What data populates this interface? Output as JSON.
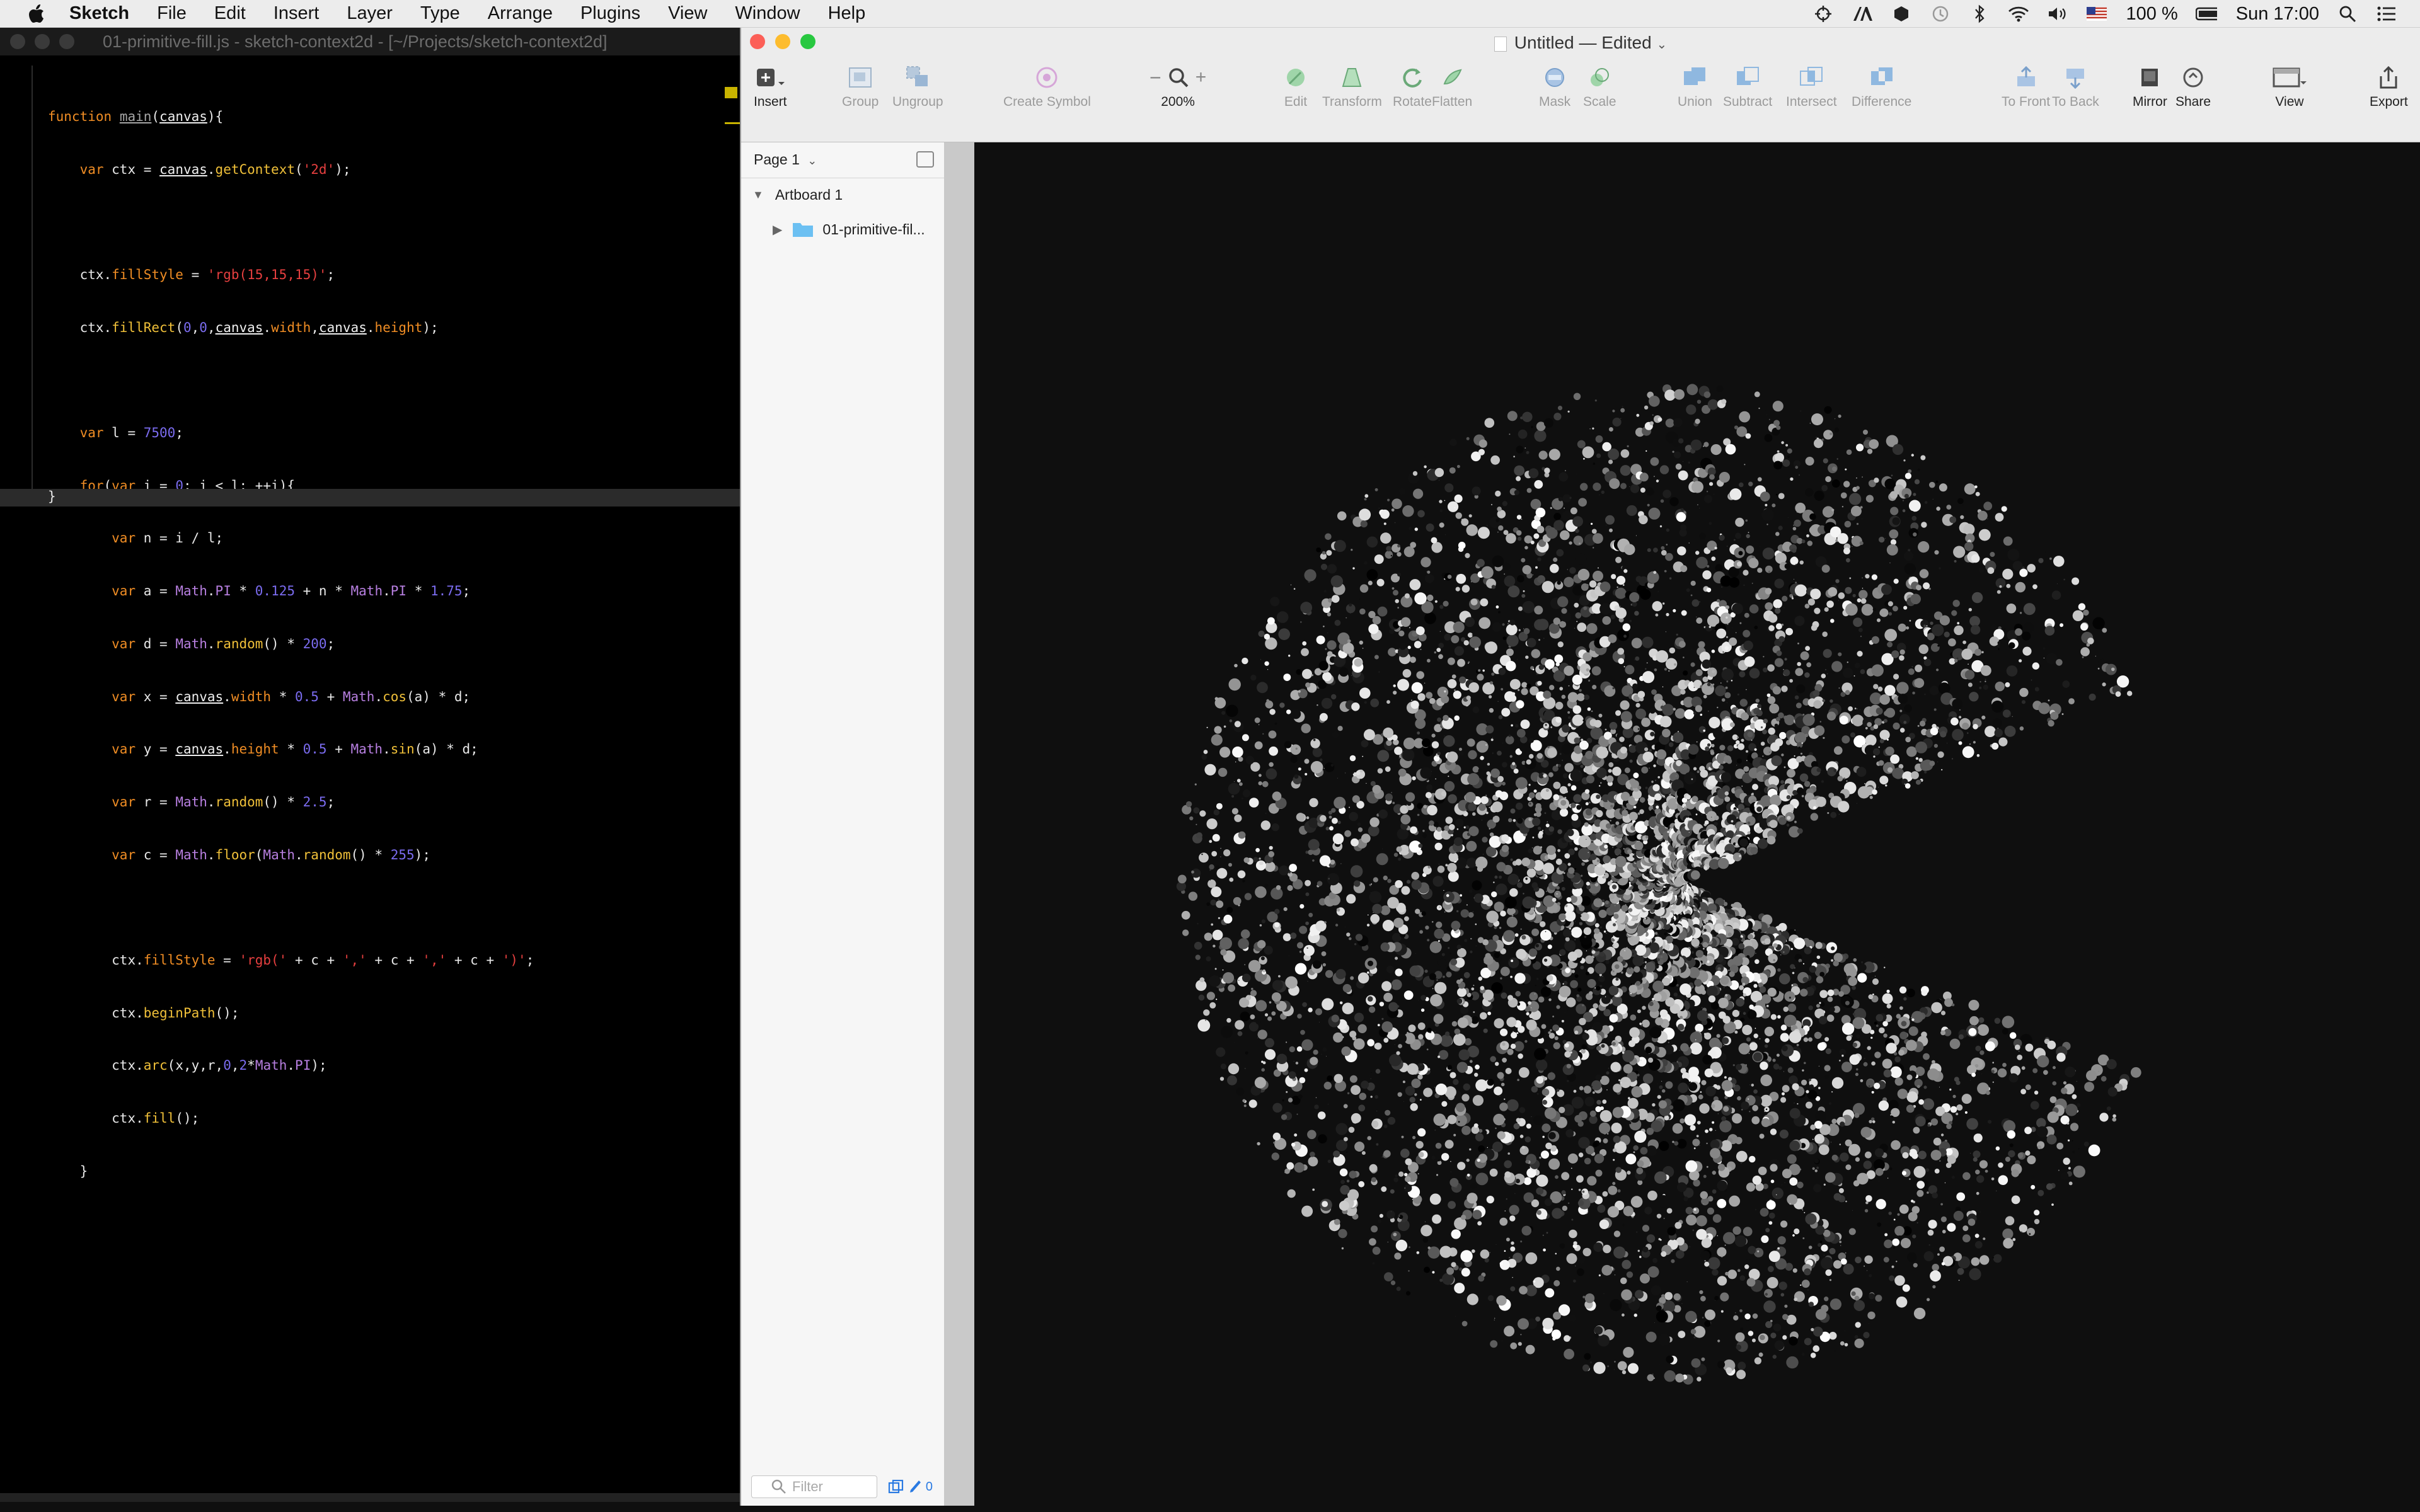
{
  "menubar": {
    "app": "Sketch",
    "items": [
      "File",
      "Edit",
      "Insert",
      "Layer",
      "Type",
      "Arrange",
      "Plugins",
      "View",
      "Window",
      "Help"
    ],
    "battery": "100 %",
    "clock": "Sun 17:00"
  },
  "editor": {
    "title": "01-primitive-fill.js - sketch-context2d - [~/Projects/sketch-context2d]",
    "closing": "}",
    "code": {
      "l1": [
        "function",
        " ",
        "main",
        "(",
        "canvas",
        "){"
      ],
      "l2": [
        "var",
        " ctx = ",
        "canvas",
        ".",
        "getContext",
        "(",
        "'2d'",
        ");"
      ],
      "l4": [
        "ctx.",
        "fillStyle",
        " = ",
        "'rgb(15,15,15)'",
        ";"
      ],
      "l5": [
        "ctx.",
        "fillRect",
        "(",
        "0",
        ",",
        "0",
        ",",
        "canvas",
        ".",
        "width",
        ",",
        "canvas",
        ".",
        "height",
        ");"
      ],
      "l7": [
        "var",
        " l = ",
        "7500",
        ";"
      ],
      "l8": [
        "for",
        "(",
        "var",
        " i = ",
        "0",
        "; i < l; ++i){"
      ],
      "l9": [
        "var",
        " n = i / l;"
      ],
      "l10": [
        "var",
        " a = ",
        "Math",
        ".",
        "PI",
        " * ",
        "0.125",
        " + n * ",
        "Math",
        ".",
        "PI",
        " * ",
        "1.75",
        ";"
      ],
      "l11": [
        "var",
        " d = ",
        "Math",
        ".",
        "random",
        "() * ",
        "200",
        ";"
      ],
      "l12": [
        "var",
        " x = ",
        "canvas",
        ".",
        "width",
        " * ",
        "0.5",
        " + ",
        "Math",
        ".",
        "cos",
        "(a) * d;"
      ],
      "l13": [
        "var",
        " y = ",
        "canvas",
        ".",
        "height",
        " * ",
        "0.5",
        " + ",
        "Math",
        ".",
        "sin",
        "(a) * d;"
      ],
      "l14": [
        "var",
        " r = ",
        "Math",
        ".",
        "random",
        "() * ",
        "2.5",
        ";"
      ],
      "l15": [
        "var",
        " c = ",
        "Math",
        ".",
        "floor",
        "(",
        "Math",
        ".",
        "random",
        "() * ",
        "255",
        ");"
      ],
      "l17": [
        "ctx.",
        "fillStyle",
        " = ",
        "'rgb('",
        " + c + ",
        "','",
        " + c + ",
        "','",
        " + c + ",
        "')'",
        ";"
      ],
      "l18": [
        "ctx.",
        "beginPath",
        "();"
      ],
      "l19": [
        "ctx.",
        "arc",
        "(x,y,r,",
        "0",
        ",",
        "2",
        "*",
        "Math",
        ".",
        "PI",
        ");"
      ],
      "l20": [
        "ctx.",
        "fill",
        "();"
      ],
      "l21": [
        "}"
      ]
    }
  },
  "sketch": {
    "title": "Untitled — Edited",
    "toolbar": {
      "insert": "Insert",
      "group": "Group",
      "ungroup": "Ungroup",
      "create_symbol": "Create Symbol",
      "zoom": "200%",
      "edit": "Edit",
      "transform": "Transform",
      "rotate": "Rotate",
      "flatten": "Flatten",
      "mask": "Mask",
      "scale": "Scale",
      "union": "Union",
      "subtract": "Subtract",
      "intersect": "Intersect",
      "difference": "Difference",
      "to_front": "To Front",
      "to_back": "To Back",
      "mirror": "Mirror",
      "share": "Share",
      "view": "View",
      "export": "Export"
    },
    "sidebar": {
      "page": "Page 1",
      "artboard": "Artboard 1",
      "group": "01-primitive-fil...",
      "filter_placeholder": "Filter",
      "edited_count": "0"
    }
  },
  "artwork": {
    "background": "#0f0f0f",
    "particle_count": 7500,
    "max_radius": 200,
    "max_dot_size": 2.5,
    "start_angle_pi": 0.125,
    "sweep_pi": 1.75
  }
}
